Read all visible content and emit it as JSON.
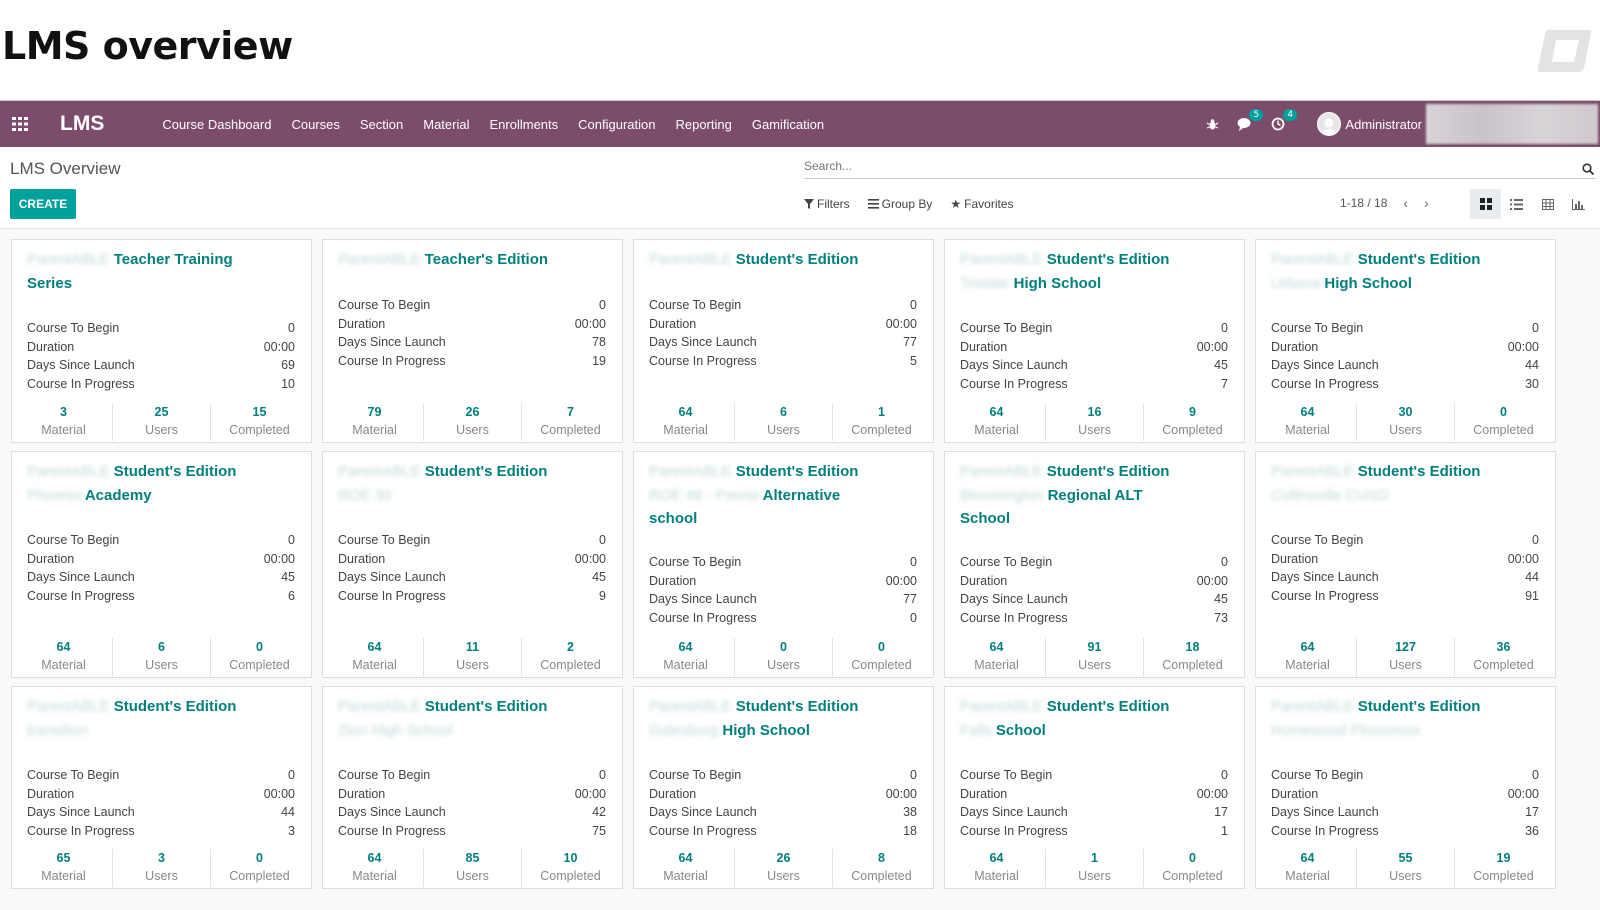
{
  "page_heading": "LMS overview",
  "navbar": {
    "brand": "LMS",
    "menu": [
      "Course Dashboard",
      "Courses",
      "Section",
      "Material",
      "Enrollments",
      "Configuration",
      "Reporting",
      "Gamification"
    ],
    "messages_badge": "5",
    "activities_badge": "4",
    "user": "Administrator"
  },
  "control_panel": {
    "title": "LMS Overview",
    "create_label": "CREATE",
    "search_placeholder": "Search...",
    "filters_label": "Filters",
    "group_by_label": "Group By",
    "favorites_label": "Favorites",
    "pager": "1-18 / 18"
  },
  "labels": {
    "course_to_begin": "Course To Begin",
    "duration": "Duration",
    "days_since_launch": "Days Since Launch",
    "course_in_progress": "Course In Progress",
    "material": "Material",
    "users": "Users",
    "completed": "Completed"
  },
  "colors": {
    "navbar": "#7c4c6b",
    "accent": "#00a09d",
    "title": "#01807d"
  },
  "cards": [
    {
      "title_blur_1": "ParentABLE",
      "title_1": "Teacher Training",
      "title_blur_2": "",
      "title_2": "Series",
      "title_blur_3": "",
      "title_3": "",
      "course_to_begin": "0",
      "duration": "00:00",
      "days_since_launch": "69",
      "course_in_progress": "10",
      "material": "3",
      "users": "25",
      "completed": "15"
    },
    {
      "title_blur_1": "ParentABLE",
      "title_1": "Teacher's Edition",
      "title_blur_2": "",
      "title_2": "",
      "title_blur_3": "",
      "title_3": "",
      "course_to_begin": "0",
      "duration": "00:00",
      "days_since_launch": "78",
      "course_in_progress": "19",
      "material": "79",
      "users": "26",
      "completed": "7"
    },
    {
      "title_blur_1": "ParentABLE",
      "title_1": "Student's Edition",
      "title_blur_2": "",
      "title_2": "",
      "title_blur_3": "",
      "title_3": "",
      "course_to_begin": "0",
      "duration": "00:00",
      "days_since_launch": "77",
      "course_in_progress": "5",
      "material": "64",
      "users": "6",
      "completed": "1"
    },
    {
      "title_blur_1": "ParentABLE",
      "title_1": "Student's Edition",
      "title_blur_2": "Tristate",
      "title_2": "High School",
      "title_blur_3": "",
      "title_3": "",
      "course_to_begin": "0",
      "duration": "00:00",
      "days_since_launch": "45",
      "course_in_progress": "7",
      "material": "64",
      "users": "16",
      "completed": "9"
    },
    {
      "title_blur_1": "ParentABLE",
      "title_1": "Student's Edition",
      "title_blur_2": "Urbana",
      "title_2": "High School",
      "title_blur_3": "",
      "title_3": "",
      "course_to_begin": "0",
      "duration": "00:00",
      "days_since_launch": "44",
      "course_in_progress": "30",
      "material": "64",
      "users": "30",
      "completed": "0"
    },
    {
      "title_blur_1": "ParentABLE",
      "title_1": "Student's Edition",
      "title_blur_2": "Phoenix",
      "title_2": "Academy",
      "title_blur_3": "",
      "title_3": "",
      "course_to_begin": "0",
      "duration": "00:00",
      "days_since_launch": "45",
      "course_in_progress": "6",
      "material": "64",
      "users": "6",
      "completed": "0"
    },
    {
      "title_blur_1": "ParentABLE",
      "title_1": "Student's Edition",
      "title_blur_2": "ROE 30",
      "title_2": "",
      "title_blur_3": "",
      "title_3": "",
      "course_to_begin": "0",
      "duration": "00:00",
      "days_since_launch": "45",
      "course_in_progress": "9",
      "material": "64",
      "users": "11",
      "completed": "2"
    },
    {
      "title_blur_1": "ParentABLE",
      "title_1": "Student's Edition",
      "title_blur_2": "ROE 48 - Peoria",
      "title_2": "Alternative",
      "title_blur_3": "",
      "title_3": "school",
      "course_to_begin": "0",
      "duration": "00:00",
      "days_since_launch": "77",
      "course_in_progress": "0",
      "material": "64",
      "users": "0",
      "completed": "0"
    },
    {
      "title_blur_1": "ParentABLE",
      "title_1": "Student's Edition",
      "title_blur_2": "Bloomington",
      "title_2": "Regional ALT",
      "title_blur_3": "",
      "title_3": "School",
      "course_to_begin": "0",
      "duration": "00:00",
      "days_since_launch": "45",
      "course_in_progress": "73",
      "material": "64",
      "users": "91",
      "completed": "18"
    },
    {
      "title_blur_1": "ParentABLE",
      "title_1": "Student's Edition",
      "title_blur_2": "Collinsville CUSD",
      "title_2": "",
      "title_blur_3": "",
      "title_3": "",
      "course_to_begin": "0",
      "duration": "00:00",
      "days_since_launch": "44",
      "course_in_progress": "91",
      "material": "64",
      "users": "127",
      "completed": "36"
    },
    {
      "title_blur_1": "ParentABLE",
      "title_1": "Student's Edition",
      "title_blur_2": "transition",
      "title_2": "",
      "title_blur_3": "",
      "title_3": "",
      "course_to_begin": "0",
      "duration": "00:00",
      "days_since_launch": "44",
      "course_in_progress": "3",
      "material": "65",
      "users": "3",
      "completed": "0"
    },
    {
      "title_blur_1": "ParentABLE",
      "title_1": "Student's Edition",
      "title_blur_2": "Zion High School",
      "title_2": "",
      "title_blur_3": "",
      "title_3": "",
      "course_to_begin": "0",
      "duration": "00:00",
      "days_since_launch": "42",
      "course_in_progress": "75",
      "material": "64",
      "users": "85",
      "completed": "10"
    },
    {
      "title_blur_1": "ParentABLE",
      "title_1": "Student's Edition",
      "title_blur_2": "Galesburg",
      "title_2": "High School",
      "title_blur_3": "",
      "title_3": "",
      "course_to_begin": "0",
      "duration": "00:00",
      "days_since_launch": "38",
      "course_in_progress": "18",
      "material": "64",
      "users": "26",
      "completed": "8"
    },
    {
      "title_blur_1": "ParentABLE",
      "title_1": "Student's Edition",
      "title_blur_2": "Falls",
      "title_2": "School",
      "title_blur_3": "",
      "title_3": "",
      "course_to_begin": "0",
      "duration": "00:00",
      "days_since_launch": "17",
      "course_in_progress": "1",
      "material": "64",
      "users": "1",
      "completed": "0"
    },
    {
      "title_blur_1": "ParentABLE",
      "title_1": "Student's Edition",
      "title_blur_2": "Homewood Flossmoor",
      "title_2": "",
      "title_blur_3": "",
      "title_3": "",
      "course_to_begin": "0",
      "duration": "00:00",
      "days_since_launch": "17",
      "course_in_progress": "36",
      "material": "64",
      "users": "55",
      "completed": "19"
    }
  ]
}
